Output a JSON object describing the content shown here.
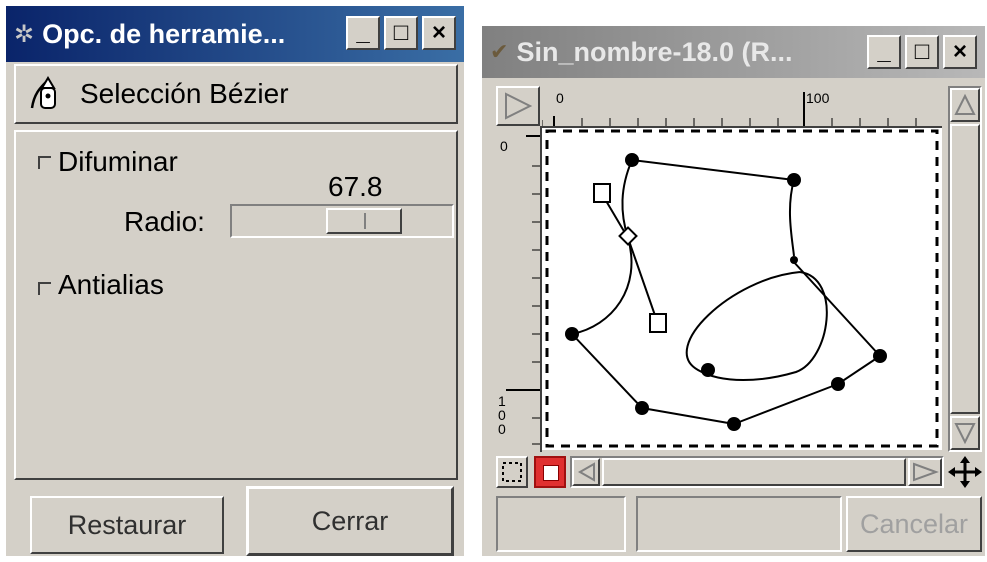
{
  "tool_options": {
    "title": "Opc. de herramie...",
    "tool_name": "Selección Bézier",
    "feather_label": "Difuminar",
    "radius_label": "Radio:",
    "radius_value": "67.8",
    "antialias_label": "Antialias",
    "reset_label": "Restaurar",
    "close_label": "Cerrar"
  },
  "image_window": {
    "title": "Sin_nombre-18.0 (R...",
    "ruler_top_0": "0",
    "ruler_top_100": "100",
    "ruler_left_0": "0",
    "ruler_left_100": "100",
    "cancel_label": "Cancelar"
  },
  "titlebar_buttons": {
    "minimize": "_",
    "maximize": "□",
    "close": "×"
  },
  "colors": {
    "active_title": "#0a246a",
    "inactive_title": "#808080",
    "window_bg": "#d4d0c8",
    "quickmask_red": "#e03030"
  }
}
